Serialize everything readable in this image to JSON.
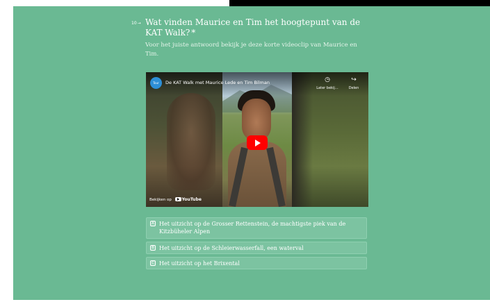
{
  "question": {
    "number": "10",
    "title": "Wat vinden Maurice en Tim het hoogtepunt van de KAT Walk?",
    "required_mark": "*",
    "description": "Voor het juiste antwoord bekijk je deze korte videoclip van Maurice en Tim."
  },
  "video": {
    "channel_badge": "Tour",
    "title": "De KAT Walk met Maurice Lede en Tim Bilman",
    "watch_later_label": "Later bekij…",
    "share_label": "Delen",
    "watch_on_label": "Bekijken op",
    "platform_label": "YouTube"
  },
  "options": [
    {
      "key": "A",
      "label": "Het uitzicht op de Grosser Rettenstein, de machtigste piek van de Kitzbüheler Alpen"
    },
    {
      "key": "B",
      "label": "Het uitzicht op de Schleierwasserfall, een waterval"
    },
    {
      "key": "C",
      "label": "Het uitzicht op het Brixental"
    }
  ],
  "colors": {
    "panel_bg": "#6ab993",
    "option_bg": "#7cc3a1",
    "play_button": "#ff0000"
  }
}
